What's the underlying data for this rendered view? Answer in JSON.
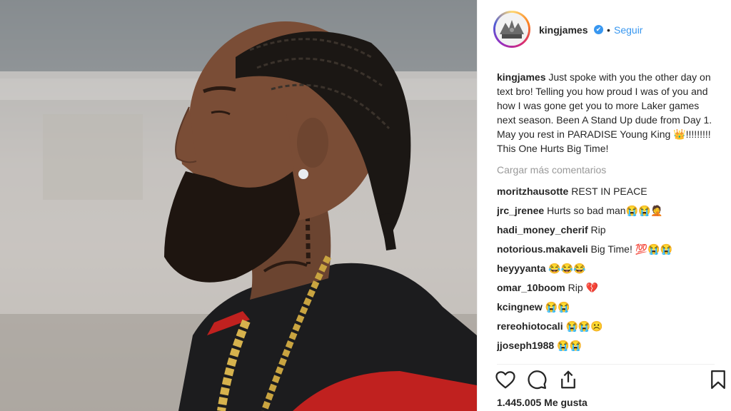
{
  "header": {
    "username": "kingjames",
    "verified_mark": "✔",
    "separator": "•",
    "follow_label": "Seguir"
  },
  "caption": {
    "username": "kingjames",
    "text": "Just spoke with you the other day on text bro! Telling you how proud I was of you and how I was gone get you to more Laker games next season. Been A Stand Up dude from Day 1. May you rest in PARADISE Young King 👑!!!!!!!!! This One Hurts Big Time!"
  },
  "load_more_label": "Cargar más comentarios",
  "comments": [
    {
      "username": "moritzhausotte",
      "text": "REST IN PEACE"
    },
    {
      "username": "jrc_jrenee",
      "text": "Hurts so bad man😭😭🤦"
    },
    {
      "username": "hadi_money_cherif",
      "text": "Rip"
    },
    {
      "username": "notorious.makaveli",
      "text": "Big Time! 💯😭😭"
    },
    {
      "username": "heyyyanta",
      "text": "😂😂😂"
    },
    {
      "username": "omar_10boom",
      "text": "Rip 💔"
    },
    {
      "username": "kcingnew",
      "text": "😭😭"
    },
    {
      "username": "rereohiotocali",
      "text": "😭😭☹️"
    },
    {
      "username": "jjoseph1988",
      "text": "😭😭"
    }
  ],
  "actions": {
    "like_icon": "heart-icon",
    "comment_icon": "comment-bubble-icon",
    "share_icon": "share-upload-icon",
    "save_icon": "bookmark-icon"
  },
  "likes_text": "1.445.005 Me gusta",
  "colors": {
    "link_blue": "#3897f0",
    "text": "#262626",
    "muted": "#999999",
    "divider": "#efefef"
  }
}
